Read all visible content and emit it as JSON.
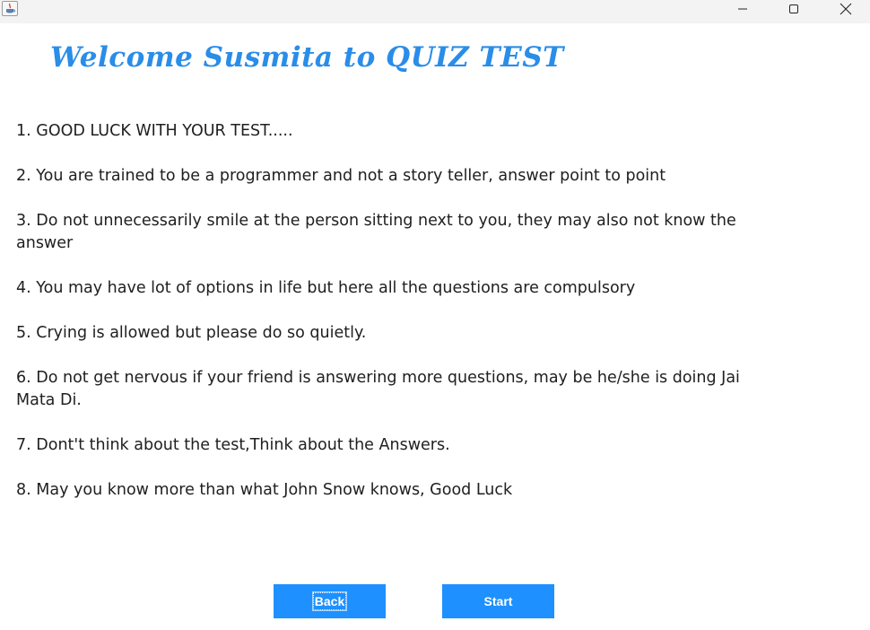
{
  "window": {
    "app_icon": "java-cup-icon",
    "controls": {
      "minimize_icon": "minimize-icon",
      "maximize_icon": "maximize-icon",
      "close_icon": "close-icon"
    }
  },
  "heading": "Welcome Susmita to QUIZ TEST",
  "rules": [
    "1. GOOD LUCK WITH YOUR TEST.....",
    "2. You are trained to be a programmer and not a story teller, answer point to point",
    "3. Do not unnecessarily smile at the person sitting next to you, they may also not know the answer",
    "4. You may have lot of options in life but here all the questions are compulsory",
    "5. Crying is allowed but please do so quietly.",
    "6. Do not get nervous if your friend is answering more questions, may be he/she is doing Jai Mata Di.",
    "7. Dont't think about the test,Think about the Answers.",
    "8. May you know more than what John Snow knows, Good Luck"
  ],
  "buttons": {
    "back_label": "Back",
    "start_label": "Start"
  },
  "colors": {
    "accent": "#1e90ff",
    "heading": "#2a8de8",
    "titlebar": "#f3f3f3"
  }
}
